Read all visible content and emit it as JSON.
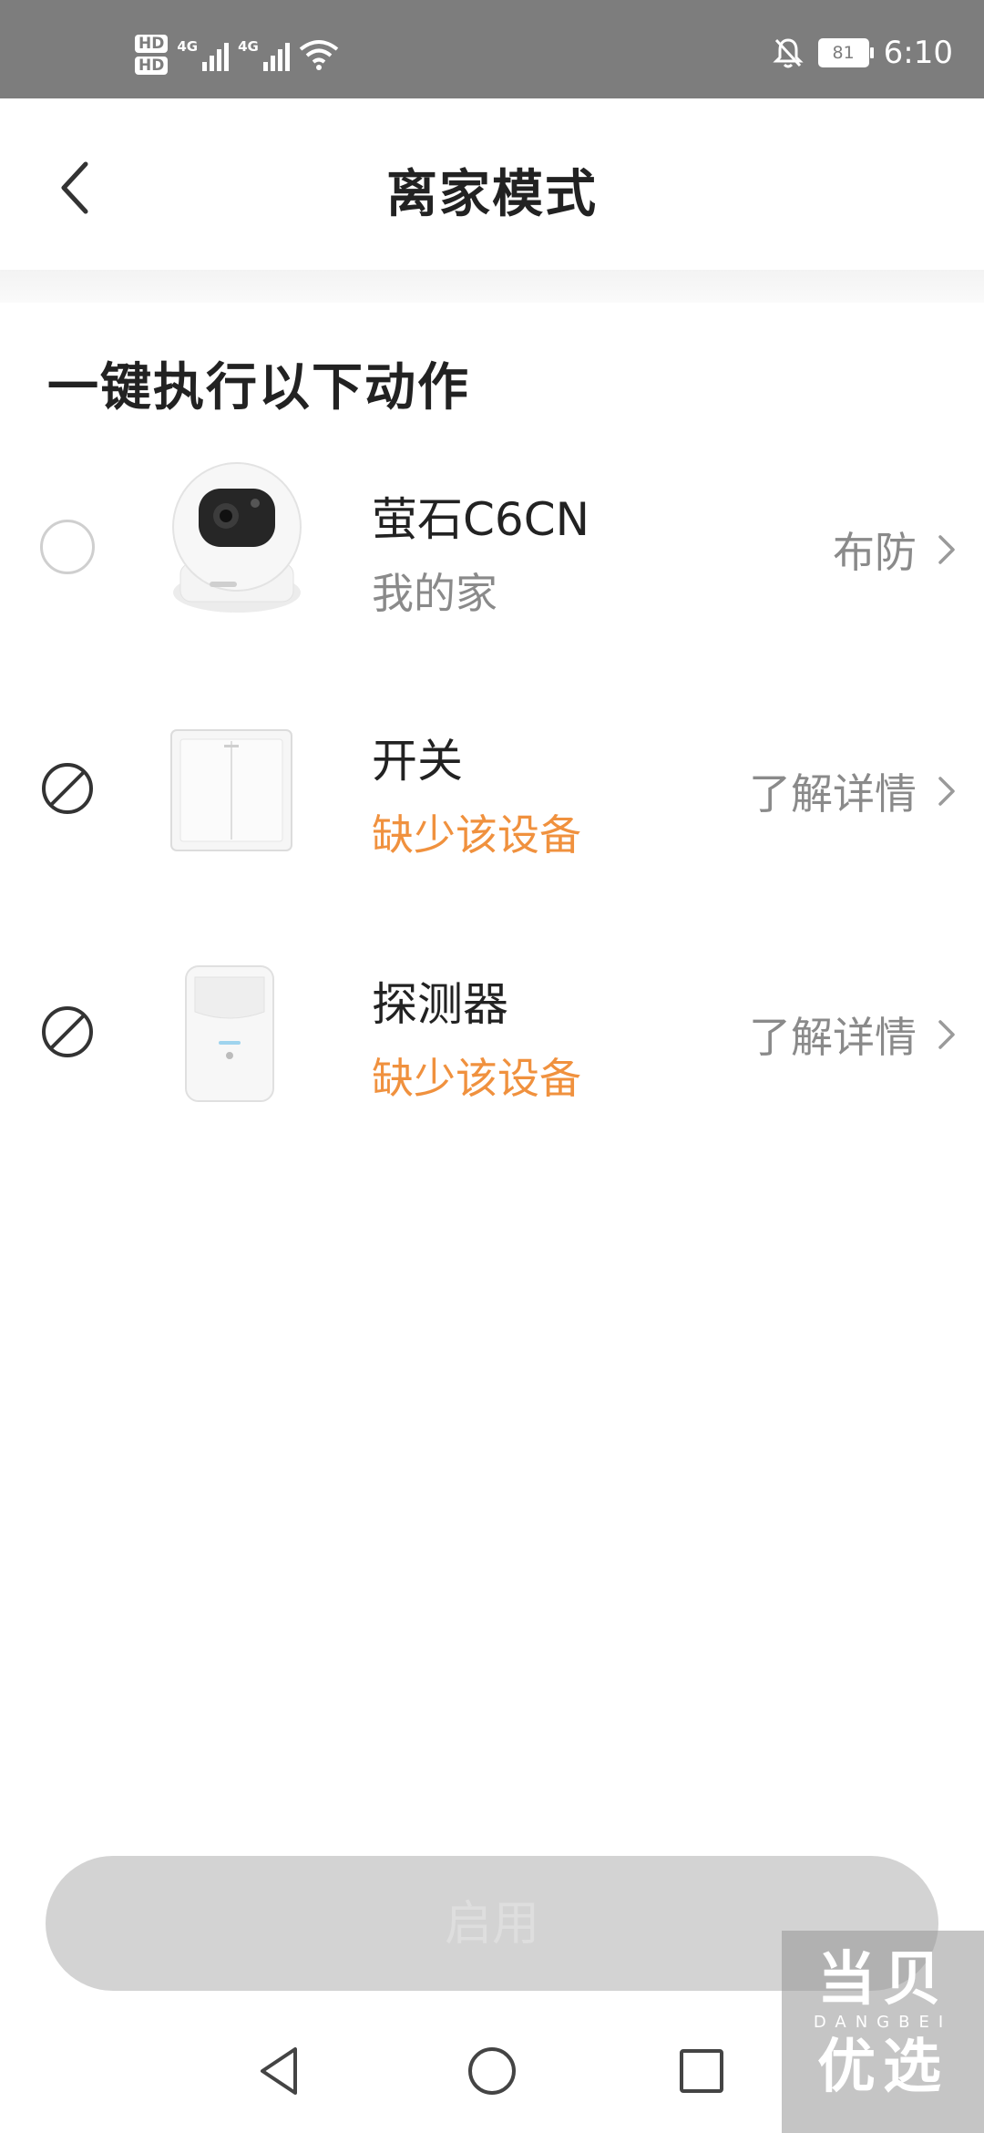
{
  "status_bar": {
    "hd1": "HD",
    "hd2": "HD",
    "sim1_label": "4G",
    "sim2_label": "4G",
    "battery": "81",
    "time": "6:10"
  },
  "header": {
    "title": "离家模式"
  },
  "section": {
    "title": "一键执行以下动作"
  },
  "devices": [
    {
      "name": "萤石C6CN",
      "subtitle": "我的家",
      "action": "布防",
      "state": "selectable"
    },
    {
      "name": "开关",
      "subtitle": "缺少该设备",
      "action": "了解详情",
      "state": "missing"
    },
    {
      "name": "探测器",
      "subtitle": "缺少该设备",
      "action": "了解详情",
      "state": "missing"
    }
  ],
  "enable_button": {
    "label": "启用"
  },
  "watermark": {
    "top": "当贝",
    "middle": "DANGBEI",
    "bottom": "优选"
  },
  "colors": {
    "status_bar": "#7d7d7d",
    "warning": "#f0913e",
    "secondary_text": "#8a8a8a",
    "disabled_button": "#d3d3d3"
  }
}
